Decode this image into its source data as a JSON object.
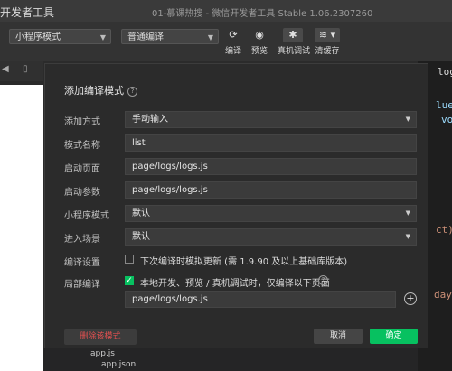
{
  "titlebar": {
    "app_title": "开发者工具",
    "window_title": "01-慕课热搜 - 微信开发者工具 Stable 1.06.2307260"
  },
  "toolbar": {
    "mode_select": "小程序模式",
    "compile_select": "普通编译",
    "buttons": [
      {
        "label": "编译",
        "icon": "refresh-icon"
      },
      {
        "label": "预览",
        "icon": "eye-icon"
      },
      {
        "label": "真机调试",
        "icon": "bug-icon"
      },
      {
        "label": "清缓存",
        "icon": "layers-icon"
      }
    ]
  },
  "editor": {
    "fragments": [
      "logs",
      "lue",
      "vo",
      "ct)",
      "day"
    ],
    "files": [
      "app.js",
      "app.json"
    ]
  },
  "dialog": {
    "title": "添加编译模式",
    "rows": [
      {
        "label": "添加方式",
        "value": "手动输入",
        "dropdown": true
      },
      {
        "label": "模式名称",
        "value": "list"
      },
      {
        "label": "启动页面",
        "value": "page/logs/logs.js"
      },
      {
        "label": "启动参数",
        "value": "page/logs/logs.js"
      },
      {
        "label": "小程序模式",
        "value": "默认",
        "dropdown": true
      },
      {
        "label": "进入场景",
        "value": "默认",
        "dropdown": true
      }
    ],
    "compile_settings": {
      "label": "编译设置",
      "checkbox_text": "下次编译时模拟更新 (需 1.9.90 及以上基础库版本)",
      "checked": false
    },
    "partial_compile": {
      "label": "局部编译",
      "checkbox_text": "本地开发、预览 / 真机调试时，仅编译以下页面",
      "checked": true,
      "page_value": "page/logs/logs.js"
    },
    "delete_button": "删除该模式",
    "cancel_button": "取消",
    "confirm_button": "确定"
  },
  "colors": {
    "accent": "#07c160",
    "danger": "#e05050",
    "background": "#2b2b2b"
  }
}
